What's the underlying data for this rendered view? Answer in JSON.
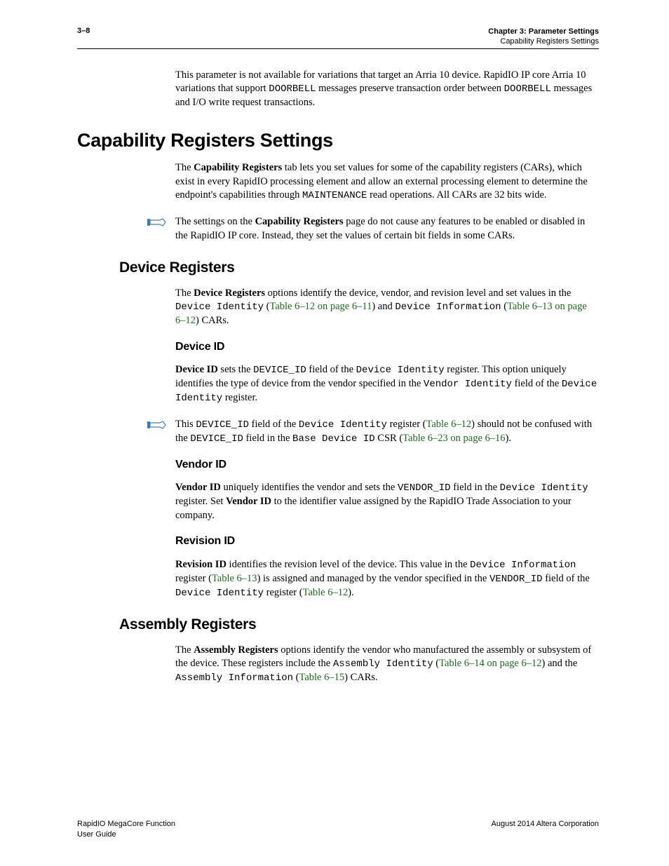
{
  "header": {
    "page_num": "3–8",
    "chapter": "Chapter 3:  Parameter Settings",
    "section": "Capability Registers Settings"
  },
  "intro_para": {
    "t1": "This parameter is not available for variations that target an Arria 10 device.  RapidIO IP core Arria 10 variations that support ",
    "c1": "DOORBELL",
    "t2": " messages preserve transaction order between ",
    "c2": "DOORBELL",
    "t3": " messages and I/O write request transactions."
  },
  "h1": "Capability Registers Settings",
  "cap_para": {
    "t1": "The ",
    "b1": "Capability Registers",
    "t2": " tab lets you set values for some of the capability registers (CARs), which exist in every RapidIO processing element and allow an external processing element to determine the endpoint's capabilities through ",
    "c1": "MAINTENANCE",
    "t3": " read operations. All CARs are 32 bits wide."
  },
  "cap_note": {
    "t1": "The settings on the ",
    "b1": "Capability Registers",
    "t2": " page do not cause any features to be enabled or disabled in the RapidIO IP core. Instead, they set the values of certain bit fields in some CARs."
  },
  "h2_device": "Device Registers",
  "dev_para": {
    "t1": "The ",
    "b1": "Device Registers",
    "t2": " options identify the device, vendor, and revision level and set values in the ",
    "c1": "Device Identity",
    "t3": " (",
    "l1": "Table 6–12 on page 6–11",
    "t4": ") and ",
    "c2": "Device Information",
    "t5": " (",
    "l2": "Table 6–13 on page 6–12",
    "t6": ") CARs."
  },
  "h3_devid": "Device ID",
  "devid_para": {
    "b1": "Device ID",
    "t1": " sets the ",
    "c1": "DEVICE_ID",
    "t2": " field of the ",
    "c2": "Device Identity",
    "t3": " register. This option uniquely identifies the type of device from the vendor specified in the ",
    "c3": "Vendor Identity",
    "t4": " field of the ",
    "c4": "Device Identity",
    "t5": " register."
  },
  "devid_note": {
    "t1": "This ",
    "c1": "DEVICE_ID",
    "t2": " field of the ",
    "c2": "Device Identity",
    "t3": " register (",
    "l1": "Table 6–12",
    "t4": ") should not be confused with the ",
    "c3": "DEVICE_ID",
    "t5": " field in the ",
    "c4": "Base Device ID",
    "t6": " CSR (",
    "l2": "Table 6–23 on page 6–16",
    "t7": ")."
  },
  "h3_vendor": "Vendor ID",
  "vendor_para": {
    "b1": "Vendor ID",
    "t1": " uniquely identifies the vendor and sets the ",
    "c1": "VENDOR_ID",
    "t2": " field in the ",
    "c2": "Device Identity",
    "t3": " register. Set ",
    "b2": "Vendor ID",
    "t4": " to the identifier value assigned by the RapidIO Trade Association to your company."
  },
  "h3_rev": "Revision ID",
  "rev_para": {
    "b1": "Revision ID",
    "t1": " identifies the revision level of the device. This value in the ",
    "c1": "Device Information",
    "t2": " register (",
    "l1": "Table 6–13",
    "t3": ") is assigned and managed by the vendor specified in the ",
    "c2": "VENDOR_ID",
    "t4": " field of the ",
    "c3": "Device Identity",
    "t5": " register (",
    "l2": "Table 6–12",
    "t6": ")."
  },
  "h2_asm": "Assembly Registers",
  "asm_para": {
    "t1": "The ",
    "b1": "Assembly Registers",
    "t2": " options identify the vendor who manufactured the assembly or subsystem of the device. These registers include the ",
    "c1": "Assembly Identity",
    "t3": " (",
    "l1": "Table 6–14 on page 6–12",
    "t4": ") and the ",
    "c2": "Assembly Information",
    "t5": " (",
    "l2": "Table 6–15",
    "t6": ") CARs."
  },
  "footer": {
    "left1": "RapidIO MegaCore Function",
    "left2": "User Guide",
    "right": "August 2014   Altera Corporation"
  }
}
